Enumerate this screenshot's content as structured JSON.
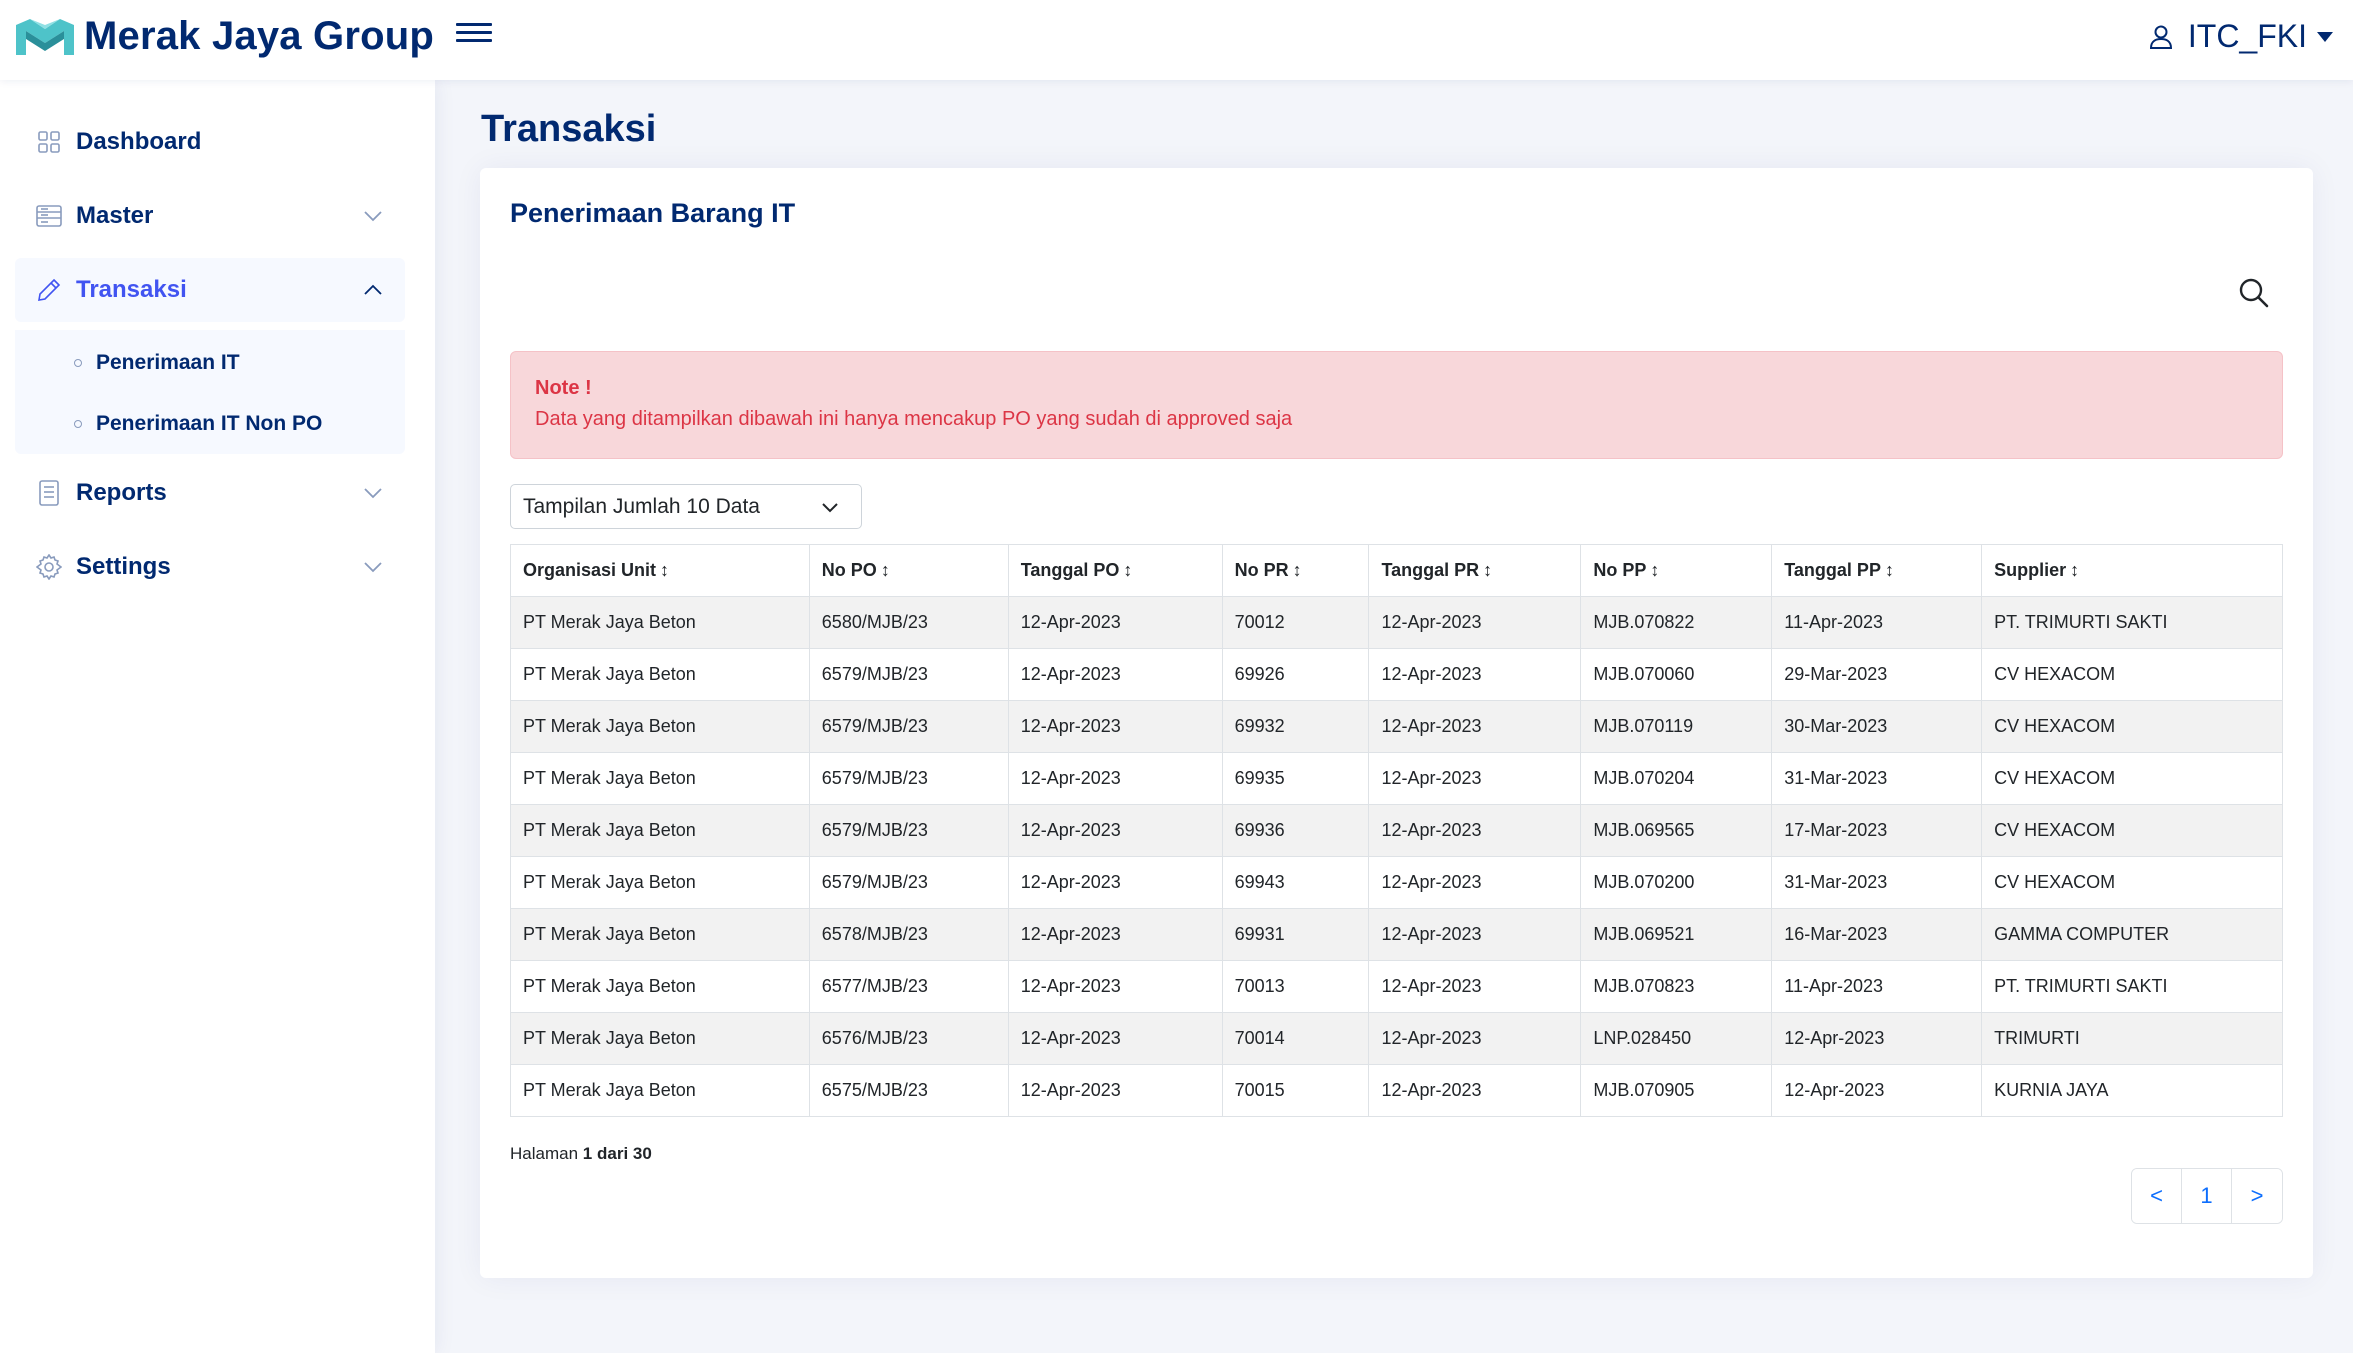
{
  "header": {
    "brand": "Merak Jaya Group",
    "user_name": "ITC_FKI"
  },
  "sidebar": {
    "items": [
      {
        "label": "Dashboard",
        "icon": "grid-icon"
      },
      {
        "label": "Master",
        "icon": "layout-icon"
      },
      {
        "label": "Transaksi",
        "icon": "pencil-icon"
      },
      {
        "label": "Reports",
        "icon": "journal-icon"
      },
      {
        "label": "Settings",
        "icon": "gear-icon"
      }
    ],
    "submenu": [
      {
        "label": "Penerimaan IT"
      },
      {
        "label": "Penerimaan IT Non PO"
      }
    ]
  },
  "main": {
    "page_title": "Transaksi",
    "card_title": "Penerimaan Barang IT",
    "note_title": "Note !",
    "note_text": "Data yang ditampilkan dibawah ini hanya mencakup PO yang sudah di approved saja",
    "page_size_select": "Tampilan Jumlah 10 Data",
    "table": {
      "headers": [
        "Organisasi Unit",
        "No PO",
        "Tanggal PO",
        "No PR",
        "Tanggal PR",
        "No PP",
        "Tanggal PP",
        "Supplier"
      ],
      "rows": [
        [
          "PT Merak Jaya Beton",
          "6580/MJB/23",
          "12-Apr-2023",
          "70012",
          "12-Apr-2023",
          "MJB.070822",
          "11-Apr-2023",
          "PT. TRIMURTI SAKTI"
        ],
        [
          "PT Merak Jaya Beton",
          "6579/MJB/23",
          "12-Apr-2023",
          "69926",
          "12-Apr-2023",
          "MJB.070060",
          "29-Mar-2023",
          "CV HEXACOM"
        ],
        [
          "PT Merak Jaya Beton",
          "6579/MJB/23",
          "12-Apr-2023",
          "69932",
          "12-Apr-2023",
          "MJB.070119",
          "30-Mar-2023",
          "CV HEXACOM"
        ],
        [
          "PT Merak Jaya Beton",
          "6579/MJB/23",
          "12-Apr-2023",
          "69935",
          "12-Apr-2023",
          "MJB.070204",
          "31-Mar-2023",
          "CV HEXACOM"
        ],
        [
          "PT Merak Jaya Beton",
          "6579/MJB/23",
          "12-Apr-2023",
          "69936",
          "12-Apr-2023",
          "MJB.069565",
          "17-Mar-2023",
          "CV HEXACOM"
        ],
        [
          "PT Merak Jaya Beton",
          "6579/MJB/23",
          "12-Apr-2023",
          "69943",
          "12-Apr-2023",
          "MJB.070200",
          "31-Mar-2023",
          "CV HEXACOM"
        ],
        [
          "PT Merak Jaya Beton",
          "6578/MJB/23",
          "12-Apr-2023",
          "69931",
          "12-Apr-2023",
          "MJB.069521",
          "16-Mar-2023",
          "GAMMA COMPUTER"
        ],
        [
          "PT Merak Jaya Beton",
          "6577/MJB/23",
          "12-Apr-2023",
          "70013",
          "12-Apr-2023",
          "MJB.070823",
          "11-Apr-2023",
          "PT. TRIMURTI SAKTI"
        ],
        [
          "PT Merak Jaya Beton",
          "6576/MJB/23",
          "12-Apr-2023",
          "70014",
          "12-Apr-2023",
          "LNP.028450",
          "12-Apr-2023",
          "TRIMURTI"
        ],
        [
          "PT Merak Jaya Beton",
          "6575/MJB/23",
          "12-Apr-2023",
          "70015",
          "12-Apr-2023",
          "MJB.070905",
          "12-Apr-2023",
          "KURNIA JAYA"
        ]
      ]
    },
    "pagination": {
      "label": "Halaman",
      "current": "1",
      "of_label": "dari",
      "total": "30",
      "prev": "<",
      "page_button": "1",
      "next": ">"
    }
  },
  "colors": {
    "primary": "#012970",
    "accent": "#4154f1",
    "danger": "#dc3545",
    "link": "#0d6efd"
  }
}
